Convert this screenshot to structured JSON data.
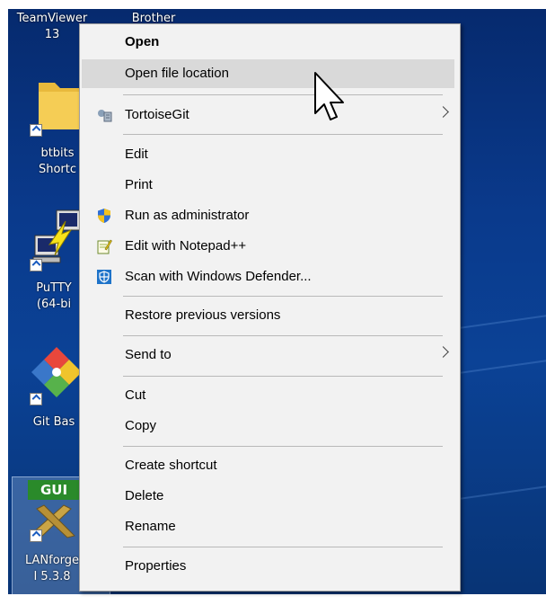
{
  "desktop": {
    "icons": [
      {
        "label": "TeamViewer",
        "label2": "13"
      },
      {
        "label": "Brother"
      },
      {
        "label": "btbits",
        "label2": "Shortc"
      },
      {
        "label": "PuTTY",
        "label2": "(64-bi"
      },
      {
        "label": "Git Bas"
      },
      {
        "label": "LANforge",
        "label2": "I 5.3.8",
        "badge": "GUI"
      }
    ]
  },
  "context_menu": {
    "items": [
      {
        "label": "Open"
      },
      {
        "label": "Open file location"
      },
      {
        "label": "TortoiseGit"
      },
      {
        "label": "Edit"
      },
      {
        "label": "Print"
      },
      {
        "label": "Run as administrator"
      },
      {
        "label": "Edit with Notepad++"
      },
      {
        "label": "Scan with Windows Defender..."
      },
      {
        "label": "Restore previous versions"
      },
      {
        "label": "Send to"
      },
      {
        "label": "Cut"
      },
      {
        "label": "Copy"
      },
      {
        "label": "Create shortcut"
      },
      {
        "label": "Delete"
      },
      {
        "label": "Rename"
      },
      {
        "label": "Properties"
      }
    ],
    "highlighted_item": "Open file location"
  },
  "colors": {
    "desktop_bg": "#0a3a8c",
    "menu_bg": "#f2f2f2",
    "menu_highlight": "#d9d9d9"
  }
}
